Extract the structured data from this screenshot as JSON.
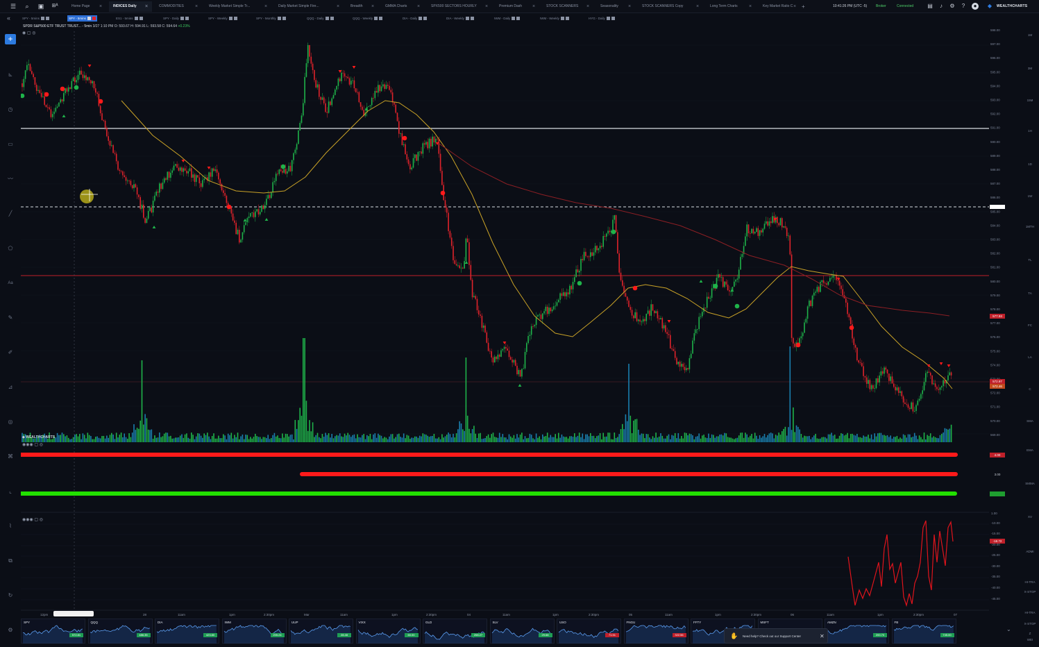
{
  "topbar": {
    "tabs": [
      {
        "label": "Home Page",
        "active": false
      },
      {
        "label": "INDICES Daily",
        "active": true
      },
      {
        "label": "COMMODITIES",
        "active": false
      },
      {
        "label": "Weekly Market Simple Tr...",
        "active": false
      },
      {
        "label": "Daily Market Simple Fire...",
        "active": false
      },
      {
        "label": "Breadth",
        "active": false
      },
      {
        "label": "GMMA Charts",
        "active": false
      },
      {
        "label": "SPX500 SECTORS HOURLY",
        "active": false
      },
      {
        "label": "Premium Dash",
        "active": false
      },
      {
        "label": "STOCK SCANNERS",
        "active": false
      },
      {
        "label": "Seasonality",
        "active": false
      },
      {
        "label": "STOCK SCANNERS Copy",
        "active": false
      },
      {
        "label": "Long Term Charts",
        "active": false
      },
      {
        "label": "Key Market Ratio C",
        "active": false
      }
    ],
    "clock": "10:41:26 PM (UTC -5)",
    "broker": "Broker",
    "connection": "Connected",
    "brand": "WEALTHCHARTS"
  },
  "layout_tabs": [
    {
      "label": "SPY - 5mins",
      "active": false
    },
    {
      "label": "SPY - 5mins",
      "active": true
    },
    {
      "label": "ES1 - 5mins",
      "active": false
    },
    {
      "label": "SPY - Daily",
      "active": false
    },
    {
      "label": "SPY - Weekly",
      "active": false
    },
    {
      "label": "SPY - Monthly",
      "active": false
    },
    {
      "label": "QQQ - Daily",
      "active": false
    },
    {
      "label": "QQQ - Weekly",
      "active": false
    },
    {
      "label": "DIA - Daily",
      "active": false
    },
    {
      "label": "DIA - Weekly",
      "active": false
    },
    {
      "label": "IWM - Daily",
      "active": false
    },
    {
      "label": "IWM - Weekly",
      "active": false
    },
    {
      "label": "HYG - Daily",
      "active": false
    }
  ],
  "chart_header": {
    "symbol": "SPDR S&P500 ETF TRUST TRUST... - 5min",
    "ohlc": "3/27 1:10 PM O: 593.67 H: 594.91 L: 593.58 C: 594.64",
    "change": "+0.23%"
  },
  "price_axis": [
    "598.00",
    "597.00",
    "596.00",
    "595.00",
    "594.00",
    "593.00",
    "592.00",
    "591.00",
    "590.00",
    "589.00",
    "588.00",
    "587.00",
    "586.00",
    "585.00",
    "584.00",
    "583.00",
    "582.00",
    "581.00",
    "580.00",
    "579.00",
    "578.00",
    "577.00",
    "576.00",
    "575.00",
    "574.00",
    "573.00",
    "572.00",
    "571.00",
    "570.00",
    "569.00"
  ],
  "price_tags": [
    {
      "label": "577.93",
      "color": "#c0202a"
    },
    {
      "label": "572.97",
      "color": "#c0202a"
    },
    {
      "label": "572.46",
      "color": "#c24a1c"
    }
  ],
  "indicator1_axis": [
    "4.00",
    "3.00",
    "2.00"
  ],
  "indicator2_axis": [
    "1.00",
    "-10.00",
    "-15.00",
    "-18.72",
    "-20.00",
    "-25.00",
    "-30.00",
    "-35.00",
    "-40.00",
    "-45.00"
  ],
  "time_axis": [
    "12pm",
    "28",
    "11am",
    "1pm",
    "2:30pm",
    "Mar",
    "11am",
    "1pm",
    "2:30pm",
    "04",
    "11am",
    "1pm",
    "2:30pm",
    "05",
    "11am",
    "1pm",
    "2:30pm",
    "06",
    "11am",
    "1pm",
    "2:30pm",
    "07"
  ],
  "right_strip": [
    "1M",
    "3M",
    "15M",
    "1H",
    "1D",
    "1W",
    "1MTH",
    "TL",
    "TA",
    "FC",
    "LA",
    "C",
    "SMA",
    "EMA",
    "SMMA",
    "XV",
    "ADMI",
    "HI-TRA",
    "X-STOP",
    "HI-TRA",
    "X-STOP",
    "Z",
    "WEI"
  ],
  "mini_charts": [
    {
      "symbol": "SPY",
      "price": "572.81",
      "color": "#1f9e54"
    },
    {
      "symbol": "QQQ",
      "price": "486.35",
      "color": "#1f9e54"
    },
    {
      "symbol": "DIA",
      "price": "423.80",
      "color": "#1f9e54"
    },
    {
      "symbol": "IWM",
      "price": "205.24",
      "color": "#1f9e54"
    },
    {
      "symbol": "UUP",
      "price": "28.48",
      "color": "#1f9e54"
    },
    {
      "symbol": "VIXX",
      "price": "60.00",
      "color": "#1f9e54"
    },
    {
      "symbol": "GLD",
      "price": "268.27",
      "color": "#1f9e54"
    },
    {
      "symbol": "SLV",
      "price": "29.68",
      "color": "#1f9e54"
    },
    {
      "symbol": "USO",
      "price": "71.51",
      "color": "#c0202a"
    },
    {
      "symbol": "FNGU",
      "price": "322.56",
      "color": "#c0202a"
    },
    {
      "symbol": "FFTY",
      "price": "",
      "color": "#1f9e54"
    },
    {
      "symbol": "MSFT",
      "price": "",
      "color": "#1f9e54"
    },
    {
      "symbol": "AMZN",
      "price": "200.70",
      "color": "#1f9e54"
    },
    {
      "symbol": "FB",
      "price": "745.00",
      "color": "#1f9e54"
    }
  ],
  "support_popup": "Need help? Check out our Support Center",
  "colors": {
    "background": "#0b0e16",
    "accent": "#2d7be0",
    "bull": "#1fb34a",
    "bear": "#e0232b",
    "ma_yellow": "#c9a227",
    "ma_red": "#b02626",
    "sell_line": "#ff1a1a",
    "buy_line": "#22e000",
    "osc_line": "#e0141c"
  },
  "icons": {
    "menu": "hamburger-icon",
    "search": "search-icon",
    "layout": "layout-icon",
    "ai": "ai-icon",
    "save": "save-icon",
    "bell": "bell-icon",
    "settings": "gear-icon",
    "help": "help-icon",
    "profile": "avatar-icon"
  }
}
